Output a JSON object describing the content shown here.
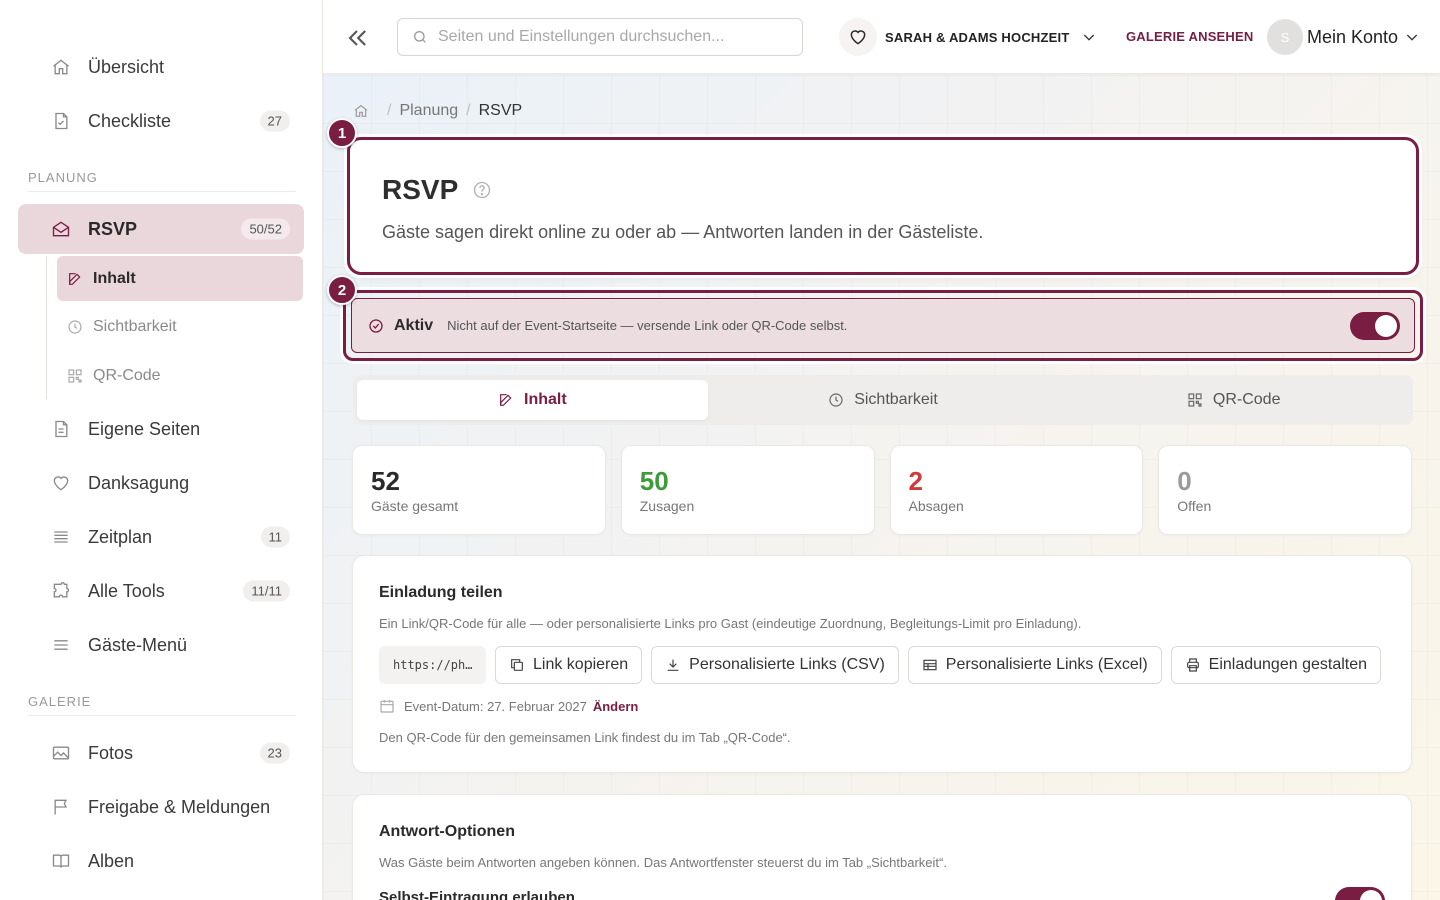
{
  "sidebar": {
    "items_top": [
      {
        "label": "Übersicht",
        "icon": "home-icon"
      },
      {
        "label": "Checkliste",
        "icon": "document-check-icon",
        "badge": "27"
      }
    ],
    "section_planung": "PLANUNG",
    "rsvp": {
      "label": "RSVP",
      "icon": "envelope-open-icon",
      "badge": "50/52"
    },
    "rsvp_sub": [
      {
        "label": "Inhalt",
        "icon": "edit-icon"
      },
      {
        "label": "Sichtbarkeit",
        "icon": "clock-icon"
      },
      {
        "label": "QR-Code",
        "icon": "qr-code-icon"
      }
    ],
    "items_planung": [
      {
        "label": "Eigene Seiten",
        "icon": "document-icon"
      },
      {
        "label": "Danksagung",
        "icon": "heart-icon"
      },
      {
        "label": "Zeitplan",
        "icon": "list-icon",
        "badge": "11"
      },
      {
        "label": "Alle Tools",
        "icon": "puzzle-icon",
        "badge": "11/11"
      },
      {
        "label": "Gäste-Menü",
        "icon": "menu-icon"
      }
    ],
    "section_galerie": "GALERIE",
    "items_galerie": [
      {
        "label": "Fotos",
        "icon": "image-icon",
        "badge": "23"
      },
      {
        "label": "Freigabe & Meldungen",
        "icon": "flag-icon"
      },
      {
        "label": "Alben",
        "icon": "book-icon"
      }
    ]
  },
  "topbar": {
    "search_placeholder": "Seiten und Einstellungen durchsuchen...",
    "event_name": "SARAH & ADAMS HOCHZEIT",
    "gallery_link": "GALERIE ANSEHEN",
    "avatar_initial": "S",
    "account_label": "Mein Konto"
  },
  "breadcrumb": {
    "parent": "Planung",
    "current": "RSVP"
  },
  "hero": {
    "title": "RSVP",
    "description": "Gäste sagen direkt online zu oder ab — Antworten landen in der Gästeliste."
  },
  "markers": [
    "1",
    "2"
  ],
  "status": {
    "label": "Aktiv",
    "note": "Nicht auf der Event-Startseite — versende Link oder QR-Code selbst.",
    "enabled": true
  },
  "tabs": [
    {
      "label": "Inhalt",
      "icon": "edit-icon",
      "active": true
    },
    {
      "label": "Sichtbarkeit",
      "icon": "clock-icon",
      "active": false
    },
    {
      "label": "QR-Code",
      "icon": "qr-code-icon",
      "active": false
    }
  ],
  "stats": [
    {
      "value": "52",
      "caption": "Gäste gesamt",
      "color": "#2a2a2a"
    },
    {
      "value": "50",
      "caption": "Zusagen",
      "color": "#3f9a3a"
    },
    {
      "value": "2",
      "caption": "Absagen",
      "color": "#d23a3a"
    },
    {
      "value": "0",
      "caption": "Offen",
      "color": "#9a9a9a"
    }
  ],
  "share": {
    "title": "Einladung teilen",
    "description": "Ein Link/QR-Code für alle — oder personalisierte Links pro Gast (eindeutige Zuordnung, Begleitungs-Limit pro Einladung).",
    "url_preview": "https://ph…",
    "buttons": [
      {
        "label": "Link kopieren",
        "icon": "copy-icon"
      },
      {
        "label": "Personalisierte Links (CSV)",
        "icon": "download-icon"
      },
      {
        "label": "Personalisierte Links (Excel)",
        "icon": "table-icon"
      },
      {
        "label": "Einladungen gestalten",
        "icon": "printer-icon"
      }
    ],
    "event_date": "Event-Datum: 27. Februar 2027",
    "change_label": "Ändern",
    "qr_hint": "Den QR-Code für den gemeinsamen Link findest du im Tab „QR-Code“."
  },
  "options": {
    "title": "Antwort-Optionen",
    "description": "Was Gäste beim Antworten angeben können. Das Antwortfenster steuerst du im Tab „Sichtbarkeit“.",
    "first_option": "Selbst-Eintragung erlauben",
    "first_option_enabled": true
  },
  "colors": {
    "accent": "#7a1d42",
    "accent_light": "#ead7dc",
    "success": "#3f9a3a",
    "danger": "#d23a3a"
  }
}
